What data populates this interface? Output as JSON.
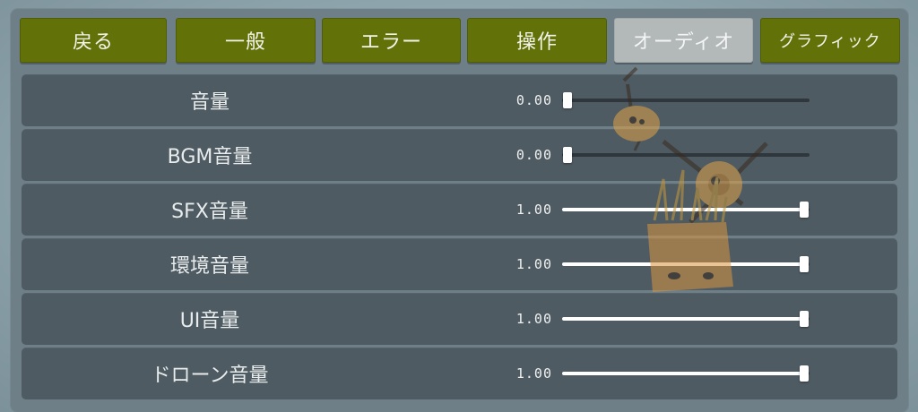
{
  "tabs": [
    {
      "label": "戻る",
      "name": "tab-back"
    },
    {
      "label": "一般",
      "name": "tab-general"
    },
    {
      "label": "エラー",
      "name": "tab-error"
    },
    {
      "label": "操作",
      "name": "tab-controls"
    },
    {
      "label": "オーディオ",
      "name": "tab-audio"
    },
    {
      "label": "グラフィック",
      "name": "tab-graphics"
    }
  ],
  "active_tab": "オーディオ",
  "settings": [
    {
      "label": "音量",
      "value": "0.00",
      "level": 0.0
    },
    {
      "label": "BGM音量",
      "value": "0.00",
      "level": 0.0
    },
    {
      "label": "SFX音量",
      "value": "1.00",
      "level": 1.0
    },
    {
      "label": "環境音量",
      "value": "1.00",
      "level": 1.0
    },
    {
      "label": "UI音量",
      "value": "1.00",
      "level": 1.0
    },
    {
      "label": "ドローン音量",
      "value": "1.00",
      "level": 1.0
    }
  ],
  "colors": {
    "tab_green": "#627209",
    "tab_active": "#b3b8b9",
    "row_bg": "#4e5b63",
    "panel_bg": "#6f7f88"
  }
}
